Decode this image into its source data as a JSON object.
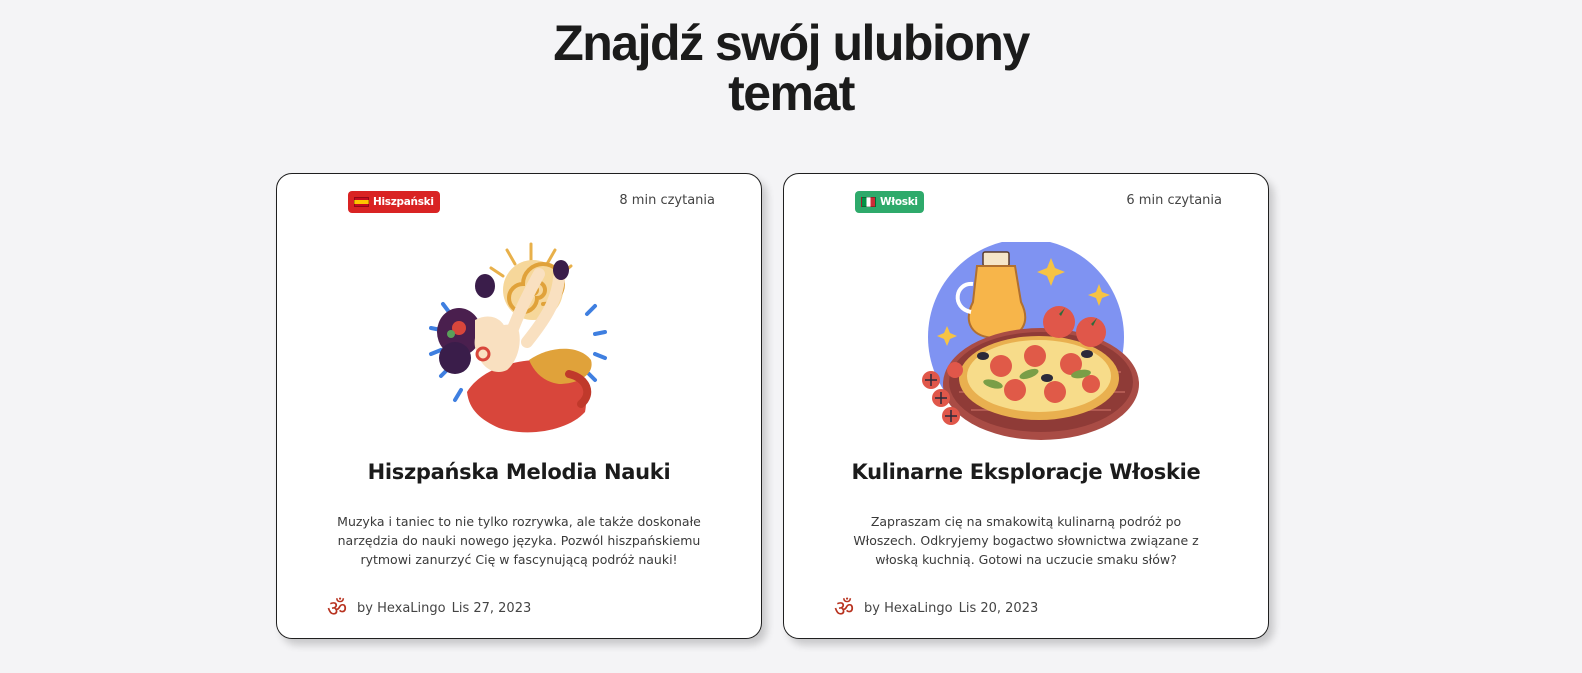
{
  "heading": {
    "line1": "Znajdź swój ulubiony",
    "line2": "temat"
  },
  "cards": [
    {
      "language": "Hiszpański",
      "language_color": "#d92323",
      "read_time": "8 min czytania",
      "title": "Hiszpańska Melodia Nauki",
      "description": "Muzyka i taniec to nie tylko rozrywka, ale także doskonałe narzędzia do nauki nowego języka. Pozwól hiszpańskiemu rytmowi zanurzyć Cię w fascynującą podróż nauki!",
      "author": "by HexaLingo",
      "date": "Lis 27, 2023",
      "author_icon": "om-icon"
    },
    {
      "language": "Włoski",
      "language_color": "#2eaa6b",
      "read_time": "6 min czytania",
      "title": "Kulinarne Eksploracje Włoskie",
      "description": "Zapraszam cię na smakowitą kulinarną podróż po Włoszech. Odkryjemy bogactwo słownictwa związane z włoską kuchnią. Gotowi na uczucie smaku słów?",
      "author": "by HexaLingo",
      "date": "Lis 20, 2023",
      "author_icon": "om-icon"
    }
  ]
}
